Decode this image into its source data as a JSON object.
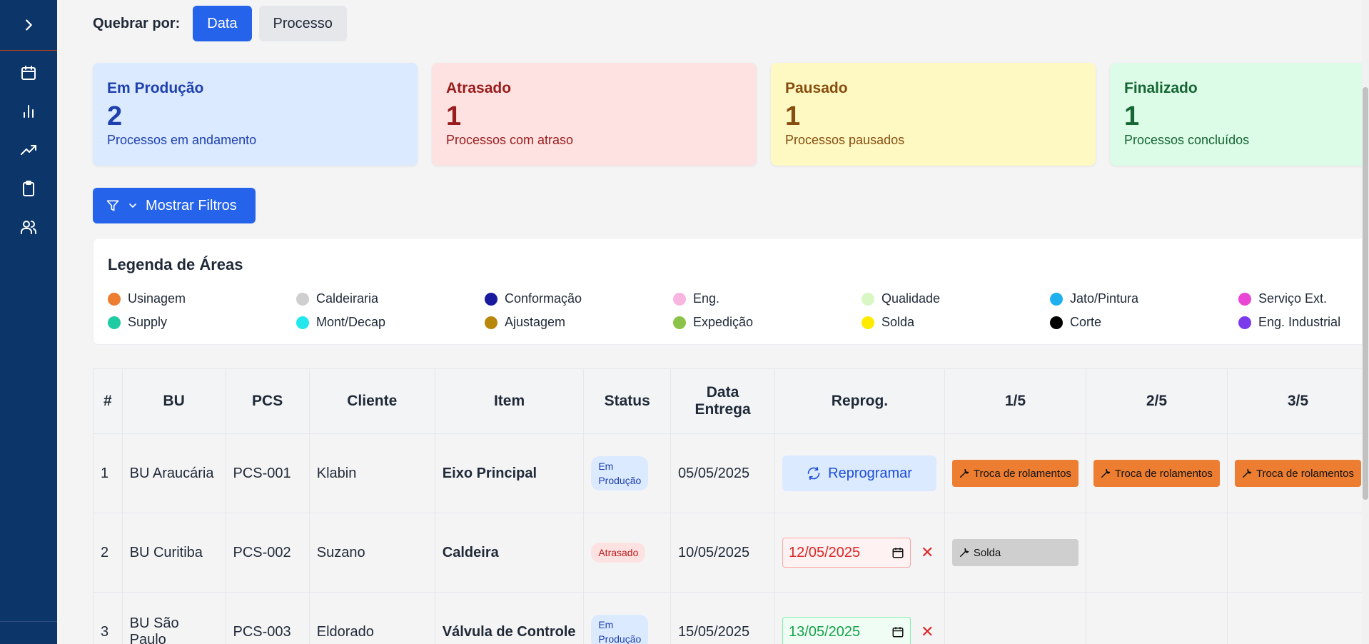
{
  "group_by": {
    "label": "Quebrar por:",
    "options": [
      "Data",
      "Processo"
    ],
    "active": "Data"
  },
  "sidebar": {
    "toggle_icon": "chevron-right-icon",
    "items": [
      "calendar-icon",
      "bar-chart-icon",
      "trending-up-icon",
      "clipboard-icon",
      "users-icon"
    ]
  },
  "cards": [
    {
      "title": "Em Produção",
      "value": "2",
      "subtitle": "Processos em andamento",
      "color": "#1e40af"
    },
    {
      "title": "Atrasado",
      "value": "1",
      "subtitle": "Processos com atraso",
      "color": "#991b1b"
    },
    {
      "title": "Pausado",
      "value": "1",
      "subtitle": "Processos pausados",
      "color": "#854d0e"
    },
    {
      "title": "Finalizado",
      "value": "1",
      "subtitle": "Processos concluídos",
      "color": "#166534"
    }
  ],
  "filters_button": "Mostrar Filtros",
  "legend": {
    "title": "Legenda de Áreas",
    "items": [
      {
        "label": "Usinagem",
        "color": "#ed7d31"
      },
      {
        "label": "Caldeiraria",
        "color": "#cfcfcf"
      },
      {
        "label": "Conformação",
        "color": "#1a1a9e"
      },
      {
        "label": "Eng.",
        "color": "#f7b5e0"
      },
      {
        "label": "Qualidade",
        "color": "#d9f7c5"
      },
      {
        "label": "Jato/Pintura",
        "color": "#1fb0f0"
      },
      {
        "label": "Serviço Ext.",
        "color": "#e946d6"
      },
      {
        "label": "Supply",
        "color": "#1fcba3"
      },
      {
        "label": "Mont/Decap",
        "color": "#22e8ee"
      },
      {
        "label": "Ajustagem",
        "color": "#b8860b"
      },
      {
        "label": "Expedição",
        "color": "#8bc34a"
      },
      {
        "label": "Solda",
        "color": "#ffeb00"
      },
      {
        "label": "Corte",
        "color": "#000000"
      },
      {
        "label": "Eng. Industrial",
        "color": "#7c3aed"
      }
    ]
  },
  "table": {
    "headers": {
      "num": "#",
      "bu": "BU",
      "pcs": "PCS",
      "cliente": "Cliente",
      "item": "Item",
      "status": "Status",
      "data_entrega_1": "Data",
      "data_entrega_2": "Entrega",
      "reprog": "Reprog.",
      "p1": "1/5",
      "p2": "2/5",
      "p3": "3/5"
    },
    "rows": [
      {
        "num": "1",
        "bu": "BU Araucária",
        "pcs": "PCS-001",
        "cliente": "Klabin",
        "item": "Eixo Principal",
        "status_1": "Em",
        "status_2": "Produção",
        "data_entrega": "05/05/2025",
        "reprog_label": "Reprogramar",
        "p1": "Troca de rolamentos",
        "p2": "Troca de rolamentos",
        "p3": "Troca de rolamentos"
      },
      {
        "num": "2",
        "bu": "BU Curitiba",
        "pcs": "PCS-002",
        "cliente": "Suzano",
        "item": "Caldeira",
        "status": "Atrasado",
        "data_entrega": "10/05/2025",
        "reprog_date": "12/05/2025",
        "p1": "Solda"
      },
      {
        "num": "3",
        "bu": "BU São Paulo",
        "pcs": "PCS-003",
        "cliente": "Eldorado",
        "item": "Válvula de Controle",
        "status_1": "Em",
        "status_2": "Produção",
        "data_entrega": "15/05/2025",
        "reprog_date": "13/05/2025"
      }
    ]
  }
}
